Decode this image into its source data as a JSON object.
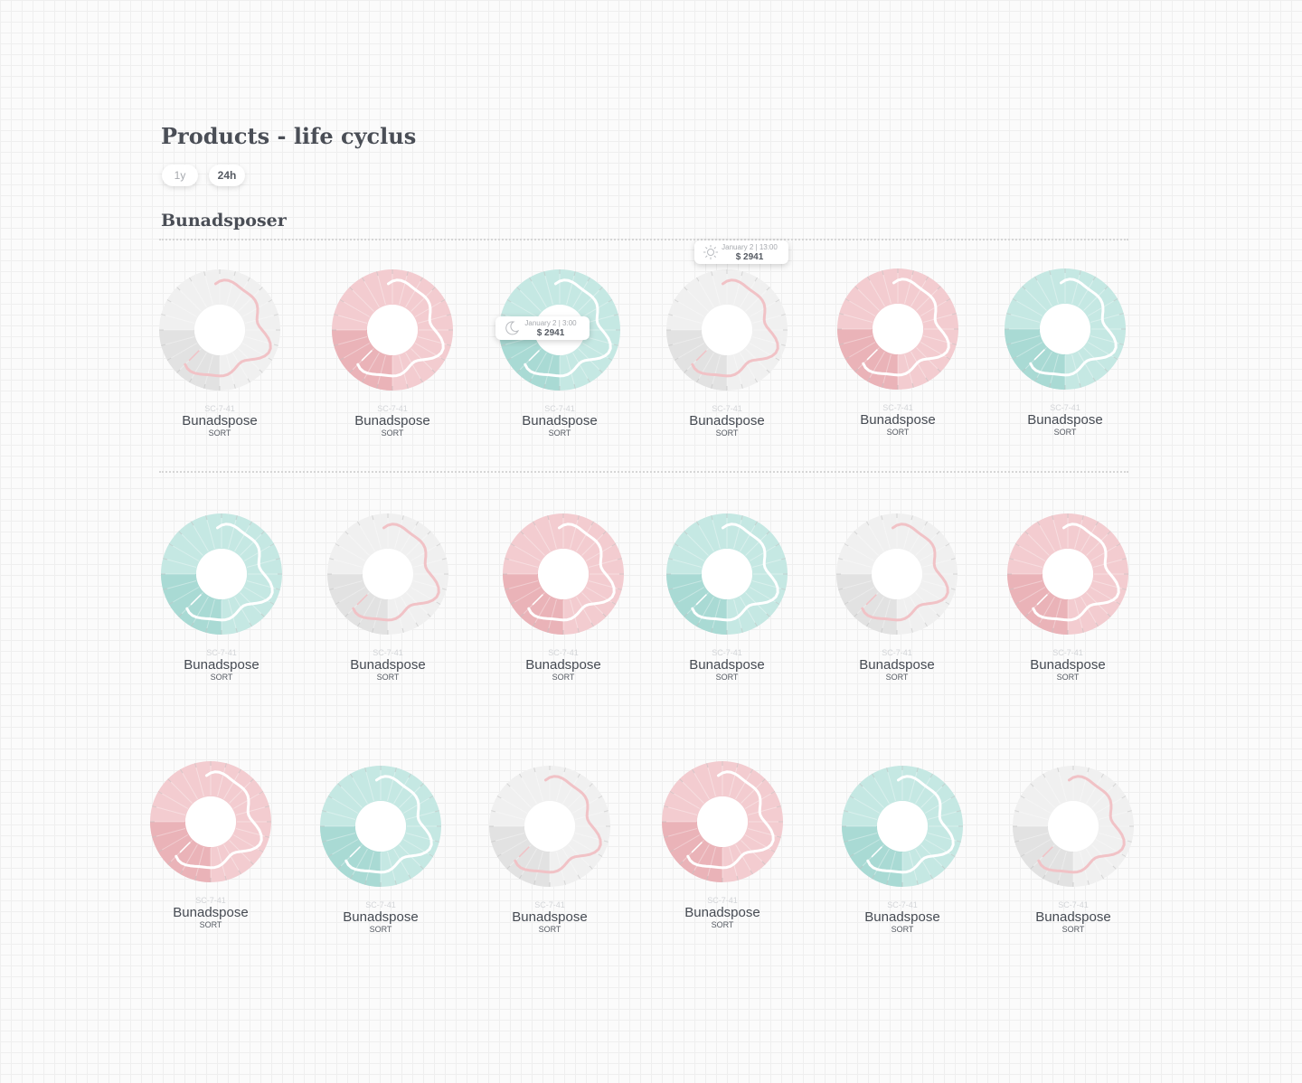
{
  "header": {
    "title": "Products - life cyclus"
  },
  "period_toggle": {
    "options": [
      "1y",
      "24h"
    ],
    "selected": "24h"
  },
  "section": {
    "title": "Bunadsposer"
  },
  "palettes": {
    "grey": {
      "light": "#f0f0f0",
      "dark": "#e2e2e2",
      "line": "#f1c2c6"
    },
    "pink": {
      "light": "#f3ccd0",
      "dark": "#eab3b8",
      "line": "#ffffff"
    },
    "mint": {
      "light": "#c5e8e3",
      "dark": "#a9dad4",
      "line": "#ffffff"
    }
  },
  "products": [
    {
      "sku": "SC-7-41",
      "name": "Bunadspose",
      "variant": "SORT",
      "theme": "grey"
    },
    {
      "sku": "SC-7-41",
      "name": "Bunadspose",
      "variant": "SORT",
      "theme": "pink"
    },
    {
      "sku": "SC-7-41",
      "name": "Bunadspose",
      "variant": "SORT",
      "theme": "mint",
      "tooltip": {
        "icon": "moon-icon",
        "date": "January 2 | 3:00",
        "price": "$ 2941"
      }
    },
    {
      "sku": "SC-7-41",
      "name": "Bunadspose",
      "variant": "SORT",
      "theme": "grey",
      "tooltip": {
        "icon": "sun-icon",
        "date": "January 2 | 13:00",
        "price": "$ 2941"
      }
    },
    {
      "sku": "SC-7-41",
      "name": "Bunadspose",
      "variant": "SORT",
      "theme": "pink"
    },
    {
      "sku": "SC-7-41",
      "name": "Bunadspose",
      "variant": "SORT",
      "theme": "mint"
    },
    {
      "sku": "SC-7-41",
      "name": "Bunadspose",
      "variant": "SORT",
      "theme": "mint"
    },
    {
      "sku": "SC-7-41",
      "name": "Bunadspose",
      "variant": "SORT",
      "theme": "grey"
    },
    {
      "sku": "SC-7-41",
      "name": "Bunadspose",
      "variant": "SORT",
      "theme": "pink"
    },
    {
      "sku": "SC-7-41",
      "name": "Bunadspose",
      "variant": "SORT",
      "theme": "mint"
    },
    {
      "sku": "SC-7-41",
      "name": "Bunadspose",
      "variant": "SORT",
      "theme": "grey"
    },
    {
      "sku": "SC-7-41",
      "name": "Bunadspose",
      "variant": "SORT",
      "theme": "pink"
    },
    {
      "sku": "SC-7-41",
      "name": "Bunadspose",
      "variant": "SORT",
      "theme": "pink"
    },
    {
      "sku": "SC-7-41",
      "name": "Bunadspose",
      "variant": "SORT",
      "theme": "mint"
    },
    {
      "sku": "SC-7-41",
      "name": "Bunadspose",
      "variant": "SORT",
      "theme": "grey"
    },
    {
      "sku": "SC-7-41",
      "name": "Bunadspose",
      "variant": "SORT",
      "theme": "pink"
    },
    {
      "sku": "SC-7-41",
      "name": "Bunadspose",
      "variant": "SORT",
      "theme": "mint"
    },
    {
      "sku": "SC-7-41",
      "name": "Bunadspose",
      "variant": "SORT",
      "theme": "grey"
    }
  ]
}
